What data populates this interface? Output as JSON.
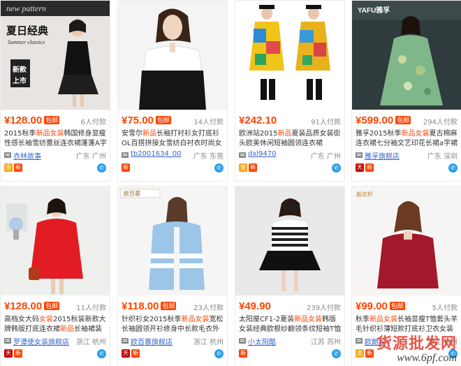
{
  "products": [
    {
      "price": "¥128.00",
      "badge": "包邮",
      "sold": "6人付款",
      "title_a": "2015秋季",
      "title_hl": "新品女装",
      "title_b": "韩国修身显瘦性感长袖雪纺蕾丝连衣裙蓬蓬A字裙",
      "shop": "衣林故事",
      "location": "广东 广州",
      "icons": [
        "gold",
        "new"
      ],
      "overlay_title": "夏日经典",
      "overlay_sub": "Summer classics",
      "overlay_brand": "new pattern",
      "overlay_tag": "新款上市"
    },
    {
      "price": "¥75.00",
      "badge": "包邮",
      "sold": "14人付款",
      "title_a": "安雪尔",
      "title_hl": "新品",
      "title_b": "长袖打衬衫女打底衫OL百搭拼接女雪纺白衬衣时尚女装潮",
      "shop": "tb2001634_00",
      "location": "广东 东莞",
      "icons": [
        "new"
      ]
    },
    {
      "price": "¥242.10",
      "badge": "",
      "sold": "91人付款",
      "title_a": "欧洲站2015",
      "title_hl": "新品",
      "title_b": "夏装品质女装街头欧美休闲短袖圆领连衣裙C6733",
      "shop": "dxl9470",
      "location": "广东 广州",
      "icons": [
        "gold",
        "new"
      ]
    },
    {
      "price": "¥599.00",
      "badge": "包邮",
      "sold": "294人付款",
      "title_a": "雅孚2015秋季",
      "title_hl": "新品女装",
      "title_b": "夏古棉麻连衣裙七分袖文艺印花长裙a字裙",
      "shop": "雅孚旗舰店",
      "location": "广东 深圳",
      "icons": [
        "tmall",
        "new"
      ],
      "overlay_logo": "YAFU雅孚"
    },
    {
      "price": "¥128.00",
      "badge": "包邮",
      "sold": "11人付款",
      "title_a": "高档女大码",
      "title_hl": "女装",
      "title_b": "2015秋装新款大牌韩版打底连衣裙",
      "title_hl2": "新品",
      "title_c": "长袖裙装外套",
      "shop": "罗谭使女装旗舰店",
      "location": "浙江 杭州",
      "icons": [
        "tmall",
        "new"
      ]
    },
    {
      "price": "¥118.00",
      "badge": "包邮",
      "sold": "23人付款",
      "title_a": "针织衫女2015秋季",
      "title_hl": "新品女装",
      "title_b": "宽松长袖圆领开衫修身中长款毛衣外套",
      "shop": "欧百慕旗舰店",
      "location": "浙江 杭州",
      "icons": [
        "tmall",
        "new"
      ],
      "overlay_logo": "欧百慕"
    },
    {
      "price": "¥49.90",
      "badge": "",
      "sold": "239人付款",
      "title_a": "太阳屋CF1-2夏装",
      "title_hl": "新品女装",
      "title_b": "韩版女装经典欧根纱翻领条纹短袖T恤衫女",
      "shop": "小太阳酷",
      "location": "江苏 苏州",
      "icons": [
        "new"
      ]
    },
    {
      "price": "¥99.00",
      "badge": "包邮",
      "sold": "5人付款",
      "title_a": "秋季",
      "title_hl": "新品女装",
      "title_b": "长袖显瘦T恤套头羊毛针织衫薄短款打底衫卫衣女装",
      "shop": "欧朗沙",
      "location": "浙江 杭州",
      "icons": [
        "gold",
        "new"
      ],
      "overlay_logo": "靓衣轩"
    }
  ],
  "watermark": {
    "line1": "货源批发网",
    "line2": "www.6pf.com"
  },
  "colors": {
    "price": "#ff4400",
    "shop_link": "#3366cc",
    "chat": "#2a9fe8",
    "tmall": "#c40000",
    "gold": "#f5a623"
  }
}
